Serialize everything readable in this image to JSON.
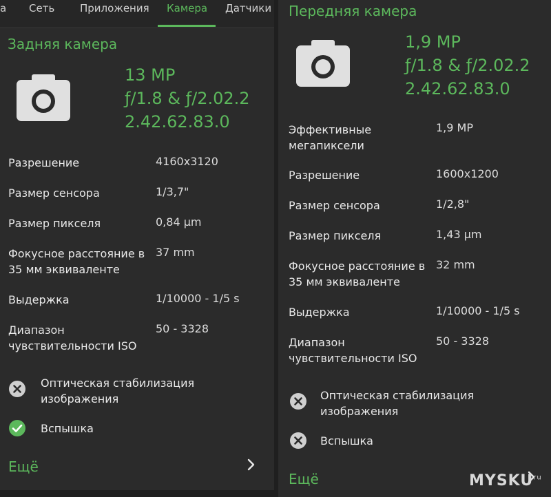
{
  "tabs": [
    {
      "label": "а"
    },
    {
      "label": "Сеть"
    },
    {
      "label": "Приложения"
    },
    {
      "label": "Камера"
    },
    {
      "label": "Датчики"
    }
  ],
  "rear": {
    "title": "Задняя камера",
    "specs": [
      "13 MP",
      "ƒ/1.8 & ƒ/2.02.2",
      "2.42.62.83.0"
    ],
    "rows": [
      {
        "label": "Разрешение",
        "value": "4160x3120"
      },
      {
        "label": "Размер сенсора",
        "value": "1/3,7\""
      },
      {
        "label": "Размер пикселя",
        "value": "0,84 µm"
      },
      {
        "label": "Фокусное расстояние в 35 мм эквиваленте",
        "value": "37 mm"
      },
      {
        "label": "Выдержка",
        "value": "1/10000 - 1/5 s"
      },
      {
        "label": "Диапазон чувствительности ISO",
        "value": "50 - 3328"
      }
    ],
    "features": [
      {
        "label": "Оптическая стабилизация изображения",
        "status": "unsupported"
      },
      {
        "label": "Вспышка",
        "status": "supported"
      }
    ],
    "more": "Ещё"
  },
  "front": {
    "title": "Передняя камера",
    "specs": [
      "1,9 MP",
      "ƒ/1.8 & ƒ/2.02.2",
      "2.42.62.83.0"
    ],
    "rows": [
      {
        "label": "Эффективные мегапиксели",
        "value": "1,9 MP"
      },
      {
        "label": "Разрешение",
        "value": "1600x1200"
      },
      {
        "label": "Размер сенсора",
        "value": "1/2,8\""
      },
      {
        "label": "Размер пикселя",
        "value": "1,43 µm"
      },
      {
        "label": "Фокусное расстояние в 35 мм эквиваленте",
        "value": "32 mm"
      },
      {
        "label": "Выдержка",
        "value": "1/10000 - 1/5 s"
      },
      {
        "label": "Диапазон чувствительности ISO",
        "value": "50 - 3328"
      }
    ],
    "features": [
      {
        "label": "Оптическая стабилизация изображения",
        "status": "unsupported"
      },
      {
        "label": "Вспышка",
        "status": "unsupported"
      }
    ],
    "more": "Ещё"
  },
  "watermark": {
    "text": "MYSKU",
    "suffix": "ru"
  },
  "colors": {
    "accent": "#5cb85c",
    "panel": "#2b2b2b",
    "icon": "#e0e0e0",
    "cross_bg": "#cfcfcf"
  },
  "icons": {
    "camera": "camera-icon",
    "unsupported": "cross-circle-icon",
    "supported": "check-circle-icon",
    "more": "chevron-right-icon"
  }
}
